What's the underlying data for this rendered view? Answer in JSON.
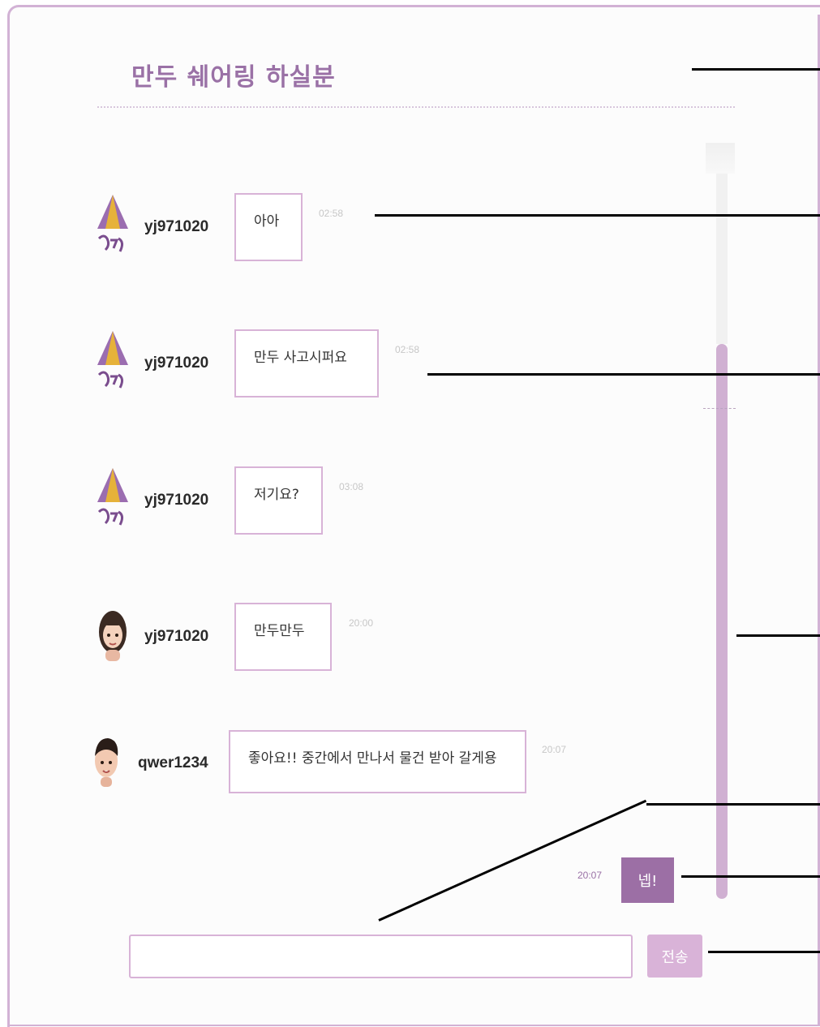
{
  "room": {
    "title": "만두 쉐어링 하실분"
  },
  "messages": [
    {
      "user": "yj971020",
      "text": "아아",
      "time": "02:58",
      "avatar": "logo-avatar"
    },
    {
      "user": "yj971020",
      "text": "만두 사고시퍼요",
      "time": "02:58",
      "avatar": "logo-avatar"
    },
    {
      "user": "yj971020",
      "text": "저기요?",
      "time": "03:08",
      "avatar": "logo-avatar"
    },
    {
      "user": "yj971020",
      "text": "만두만두",
      "time": "20:00",
      "avatar": "girl-avatar"
    },
    {
      "user": "qwer1234",
      "text": "좋아요!! 중간에서 만나서 물건 받아 갈게용",
      "time": "20:07",
      "avatar": "boy-avatar"
    }
  ],
  "my_message": {
    "text": "넵!",
    "time": "20:07"
  },
  "composer": {
    "placeholder": "",
    "send_label": "전송"
  },
  "colors": {
    "accent": "#9c6fa5",
    "border": "#d8b3d7",
    "send": "#d9b3d8",
    "title": "#9a71a6"
  }
}
